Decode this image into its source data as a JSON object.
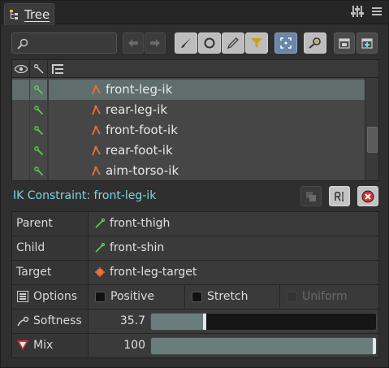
{
  "window": {
    "tab_label": "Tree"
  },
  "toolbar": {
    "search_placeholder": ""
  },
  "tree": {
    "rows": [
      {
        "label": "front-leg-ik",
        "selected": true
      },
      {
        "label": "rear-leg-ik",
        "selected": false
      },
      {
        "label": "front-foot-ik",
        "selected": false
      },
      {
        "label": "rear-foot-ik",
        "selected": false
      },
      {
        "label": "aim-torso-ik",
        "selected": false
      }
    ]
  },
  "constraint": {
    "title": "IK Constraint: front-leg-ik",
    "parent_label": "Parent",
    "parent_value": "front-thigh",
    "child_label": "Child",
    "child_value": "front-shin",
    "target_label": "Target",
    "target_value": "front-leg-target",
    "options_label": "Options",
    "positive_label": "Positive",
    "stretch_label": "Stretch",
    "uniform_label": "Uniform",
    "softness_label": "Softness",
    "softness_value": "35.7",
    "softness_fraction": 0.238,
    "mix_label": "Mix",
    "mix_value": "100",
    "mix_fraction": 1.0
  },
  "colors": {
    "title_text": "#7fd3e6",
    "selected_row": "#5f6d6d",
    "bone_green": "#5fcf4f",
    "ik_orange": "#e8703a",
    "delete_red": "#d83030",
    "active_blue": "#6a86a8"
  }
}
